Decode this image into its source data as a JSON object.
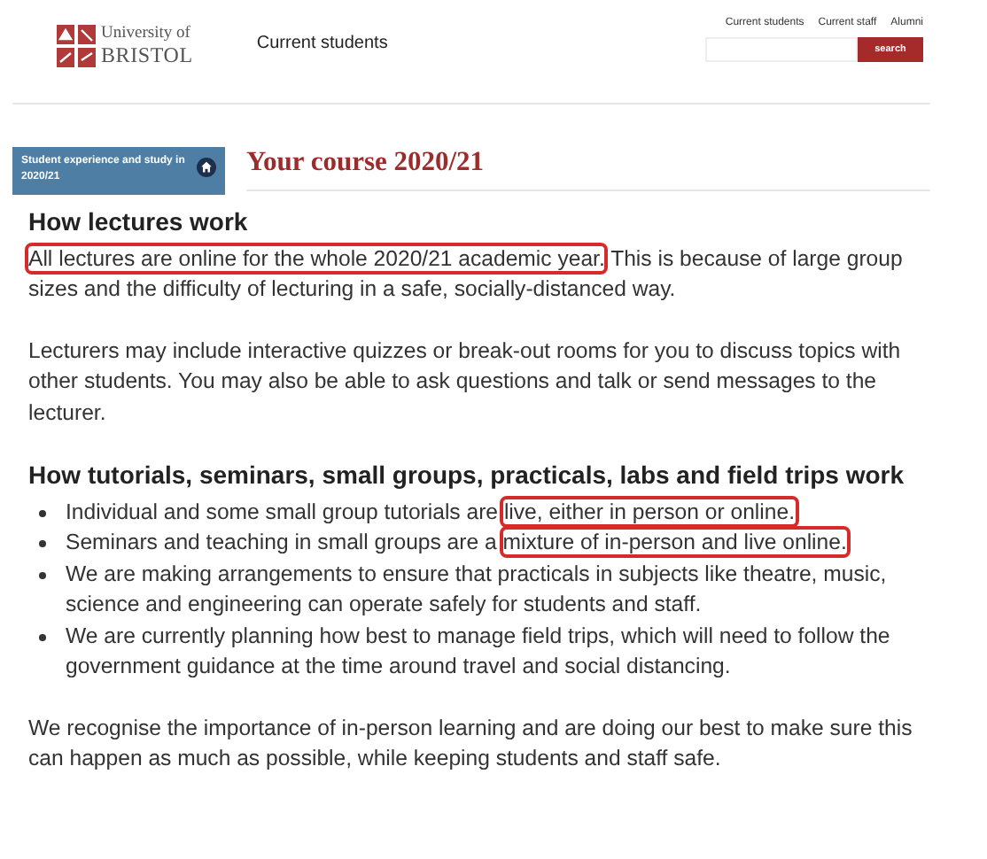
{
  "header": {
    "logo": {
      "line_1": "University of",
      "line_2": "BRISTOL"
    },
    "site_title": "Current students",
    "top_links": [
      "Current students",
      "Current staff",
      "Alumni"
    ],
    "search": {
      "button": "search"
    }
  },
  "sidebar": {
    "label": "Student experience and study in 2020/21"
  },
  "page_title": "Your course 2020/21",
  "sections": [
    {
      "heading": "How lectures work",
      "blocks": [
        {
          "kind": "paragraph",
          "segments": [
            {
              "text": "All lectures are online for the whole 2020/21 academic year.",
              "highlighted": true
            },
            {
              "text": " This is because of large group sizes and the difficulty of lecturing in a safe, socially-distanced way.",
              "highlighted": false
            }
          ]
        },
        {
          "kind": "paragraph",
          "segments": [
            {
              "text": "Lecturers may include interactive quizzes or break-out rooms for you to discuss topics with other students. You may also be able to ask questions and talk or send messages to the lecturer.",
              "highlighted": false
            }
          ]
        }
      ]
    },
    {
      "heading": "How tutorials, seminars, small groups, practicals, labs and field trips work",
      "blocks": [
        {
          "kind": "list",
          "items": [
            {
              "segments": [
                {
                  "text": "Individual and some small group tutorials are ",
                  "highlighted": false
                },
                {
                  "text": "live, either in person or online.",
                  "highlighted": true
                }
              ]
            },
            {
              "segments": [
                {
                  "text": "Seminars and teaching in small groups are a ",
                  "highlighted": false
                },
                {
                  "text": "mixture of in-person and live online.",
                  "highlighted": true
                }
              ]
            },
            {
              "segments": [
                {
                  "text": "We are making arrangements to ensure that practicals in subjects like theatre, music, science and engineering can operate safely for students and staff.",
                  "highlighted": false
                }
              ]
            },
            {
              "segments": [
                {
                  "text": "We are currently planning how best to manage field trips, which will need to follow the government guidance at the time around travel and social distancing.",
                  "highlighted": false
                }
              ]
            }
          ]
        },
        {
          "kind": "paragraph",
          "segments": [
            {
              "text": "We recognise the importance of in-person learning and are doing our best to make sure this can happen as much as possible, while keeping students and staff safe.",
              "highlighted": false
            }
          ]
        }
      ]
    }
  ]
}
